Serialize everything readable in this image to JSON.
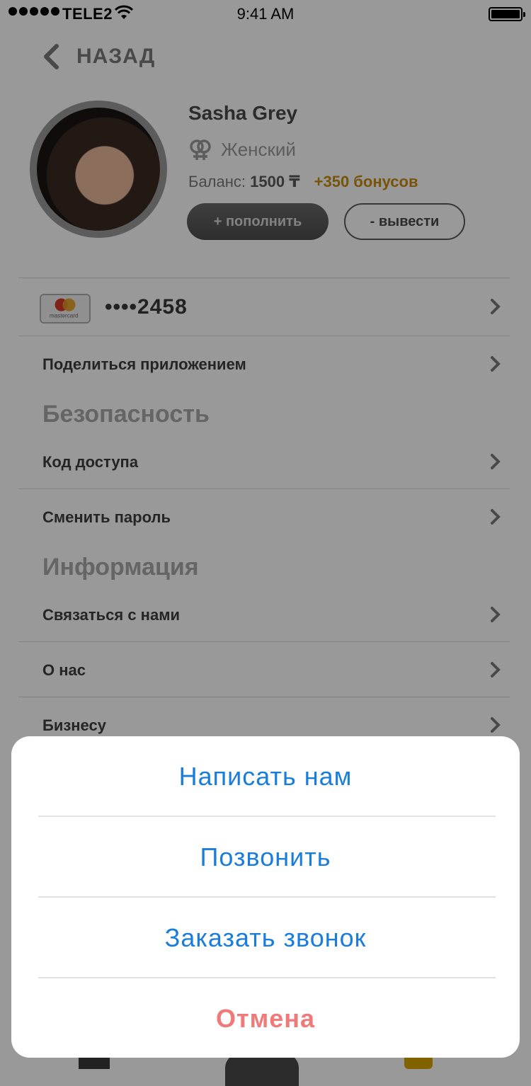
{
  "status_bar": {
    "carrier": "TELE2",
    "time": "9:41 AM"
  },
  "nav": {
    "back_label": "НАЗАД"
  },
  "profile": {
    "name": "Sasha Grey",
    "gender": "Женский",
    "balance_label": "Баланс:",
    "balance_value": "1500 ₸",
    "bonus": "+350 бонусов",
    "topup_label": "+ пополнить",
    "withdraw_label": "- вывести"
  },
  "card": {
    "brand": "mastercard",
    "masked_number": "••••",
    "last_digits": "2458"
  },
  "menu": {
    "share_label": "Поделиться приложением",
    "security_title": "Безопасность",
    "access_code_label": "Код доступа",
    "change_password_label": "Сменить пароль",
    "info_title": "Информация",
    "contact_label": "Связаться с нами",
    "about_label": "О нас",
    "business_label": "Бизнесу"
  },
  "action_sheet": {
    "write_label": "Написать нам",
    "call_label": "Позвонить",
    "callback_label": "Заказать звонок",
    "cancel_label": "Отмена"
  },
  "colors": {
    "accent_blue": "#1a7ddb",
    "cancel_red": "#f07a7a",
    "bonus_orange": "#c88a12"
  }
}
